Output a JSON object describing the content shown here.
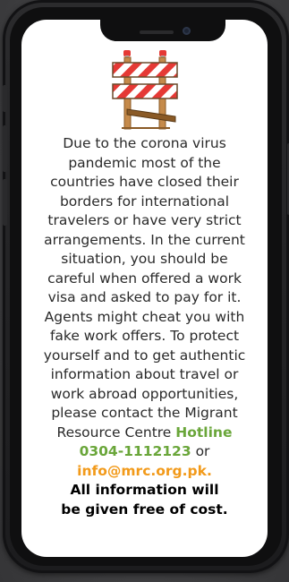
{
  "message": {
    "line1": "Due to the corona virus",
    "line2": "pandemic most of the",
    "line3": "countries have closed their",
    "line4": "borders for international",
    "line5": "travelers or have very strict",
    "line6": "arrangements. In the current",
    "line7": "situation, you should be",
    "line8": "careful when offered a work",
    "line9": "visa and asked  to pay for it.",
    "line10": "Agents might cheat you with",
    "line11": "fake work offers. To protect",
    "line12": "yourself and to get authentic",
    "line13": "information about travel or",
    "line14": "work abroad opportunities,",
    "line15": "please contact the Migrant",
    "line16_prefix": "Resource Centre ",
    "hotline_label": "Hotline",
    "hotline_number": "0304-1112123",
    "or_text": " or",
    "email": "info@mrc.org.pk.",
    "closing_line1": "All information will",
    "closing_line2": "be given free of cost."
  },
  "colors": {
    "accent_green": "#6aa63a",
    "accent_orange": "#f29a1a",
    "barrier_red": "#e53935",
    "phone_frame": "#1c1c1e",
    "background": "#4a4a4c"
  },
  "icons": {
    "barrier": "road-barrier-icon"
  }
}
